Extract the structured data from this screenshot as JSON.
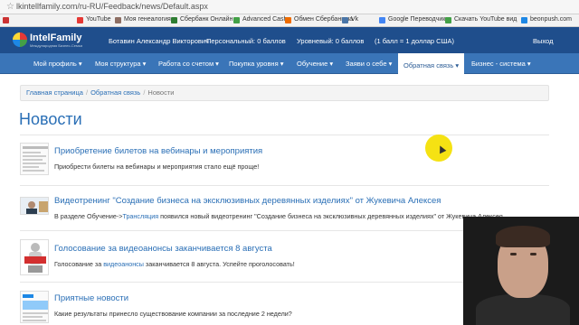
{
  "browser": {
    "url": "lkintellfamily.com/ru-RU/Feedback/news/Default.aspx",
    "bookmarks": [
      "YouTube",
      "Моя генеалогия",
      "Сбербанк Онлайн",
      "Advanced Cash",
      "Обмен Сбербанк на",
      "Vk",
      "Google Переводчик",
      "Скачать YouTube вид",
      "beonpush.com"
    ]
  },
  "header": {
    "logo": "IntelFamily",
    "logo_sub": "Международная Бизнес-Семья",
    "user_name": "Ботавин Александр Викторович",
    "personal": "Персональный: 0 баллов",
    "level": "Уровневый: 0 баллов",
    "rate": "(1 балл = 1 доллар США)",
    "logout": "Выход"
  },
  "nav": {
    "items": [
      "Мой профиль ▾",
      "Моя структура ▾",
      "Работа со счетом ▾",
      "Покупка уровня ▾",
      "Обучение ▾",
      "Заяви о себе ▾",
      "Обратная связь ▾",
      "Бизнес - система ▾"
    ],
    "active_index": 6
  },
  "breadcrumb": {
    "home": "Главная страница",
    "section": "Обратная связь",
    "current": "Новости",
    "separator": "/"
  },
  "page": {
    "title": "Новости"
  },
  "news": [
    {
      "title": "Приобретение билетов на вебинары и мероприятия",
      "desc": "Приобрести билеты на вебинары и мероприятия стало ещё проще!"
    },
    {
      "title": "Видеотренинг \"Создание бизнеса на эксклюзивных деревянных изделиях\" от Жукевича Алексея",
      "desc_pre": "В разделе Обучение->",
      "desc_link": "Трансляция",
      "desc_post": " появился новый видеотренинг \"Создание бизнеса на эксклюзивных деревянных изделиях\" от Жукевича Алексея."
    },
    {
      "title": "Голосование за видеоанонсы заканчивается 8 августа",
      "desc_pre": "Голосование за ",
      "desc_link": "видеоанонсы",
      "desc_post": " заканчивается 8 августа. Успейте проголосовать!"
    },
    {
      "title": "Приятные новости",
      "desc": "Какие результаты принесло существование компании за последние 2 недели?"
    }
  ],
  "colors": {
    "header_bg": "#1f4e8c",
    "nav_bg": "#3a75b8",
    "link": "#2a6fb6",
    "cursor_highlight": "#f5e000"
  }
}
